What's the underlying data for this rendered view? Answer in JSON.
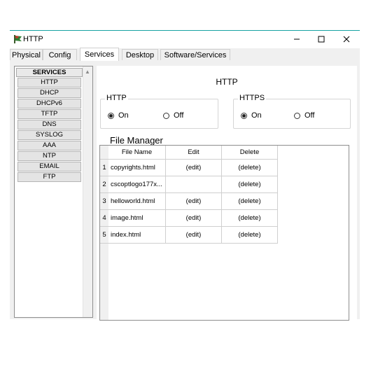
{
  "window": {
    "title": "HTTP"
  },
  "tabs": [
    {
      "label": "Physical"
    },
    {
      "label": "Config"
    },
    {
      "label": "Services",
      "active": true
    },
    {
      "label": "Desktop"
    },
    {
      "label": "Software/Services"
    }
  ],
  "services": {
    "header": "SERVICES",
    "items": [
      "HTTP",
      "DHCP",
      "DHCPv6",
      "TFTP",
      "DNS",
      "SYSLOG",
      "AAA",
      "NTP",
      "EMAIL",
      "FTP"
    ]
  },
  "panel": {
    "title": "HTTP",
    "http_group": {
      "label": "HTTP",
      "on": "On",
      "off": "Off",
      "selected": "On"
    },
    "https_group": {
      "label": "HTTPS",
      "on": "On",
      "off": "Off",
      "selected": "On"
    }
  },
  "file_manager": {
    "title": "File Manager",
    "columns": [
      "File Name",
      "Edit",
      "Delete"
    ],
    "rows": [
      {
        "index": "1",
        "name": "copyrights.html",
        "edit": "(edit)",
        "delete": "(delete)"
      },
      {
        "index": "2",
        "name": "cscoptlogo177x...",
        "edit": "",
        "delete": "(delete)"
      },
      {
        "index": "3",
        "name": "helloworld.html",
        "edit": "(edit)",
        "delete": "(delete)"
      },
      {
        "index": "4",
        "name": "image.html",
        "edit": "(edit)",
        "delete": "(delete)"
      },
      {
        "index": "5",
        "name": "index.html",
        "edit": "(edit)",
        "delete": "(delete)"
      }
    ]
  },
  "colors": {
    "title_border": "#17a2a2",
    "window_bg": "#f0f0f0"
  }
}
